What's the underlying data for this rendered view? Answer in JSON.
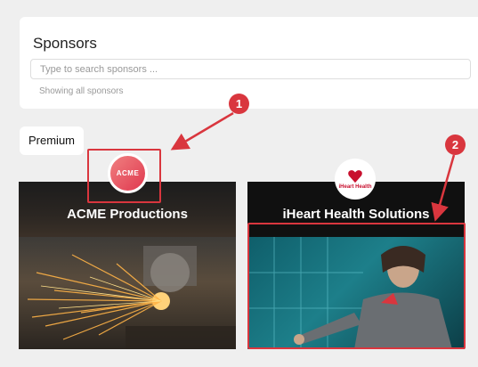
{
  "section": {
    "title": "Sponsors"
  },
  "search": {
    "placeholder": "Type to search sponsors ...",
    "value": "",
    "status": "Showing all sponsors"
  },
  "tier": {
    "label": "Premium"
  },
  "sponsors": [
    {
      "name": "ACME Productions",
      "logo_text": "ACME",
      "logo_color": "#e0384f"
    },
    {
      "name": "iHeart Health Solutions",
      "logo_text": "iHeart Health",
      "logo_color": "#c8102e"
    }
  ],
  "annotations": [
    {
      "label": "1",
      "color": "#d9363e"
    },
    {
      "label": "2",
      "color": "#d9363e"
    }
  ]
}
